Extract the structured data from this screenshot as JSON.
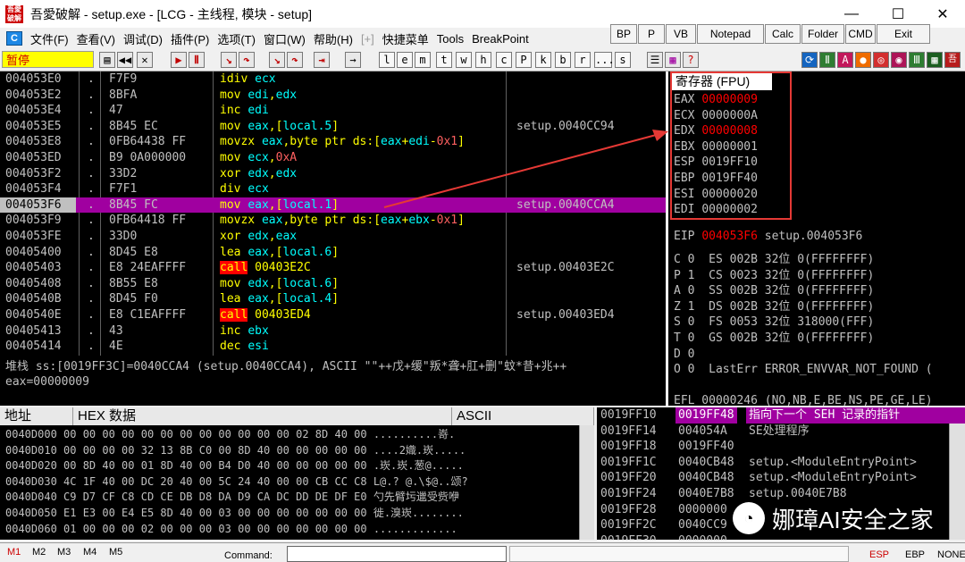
{
  "window": {
    "title": "吾愛破解 - setup.exe - [LCG - 主线程, 模块 - setup]",
    "icon_text": "吾愛破解",
    "minimize": "—",
    "maximize": "☐",
    "close": "✕"
  },
  "menu": {
    "logo": "C",
    "items": [
      "文件(F)",
      "查看(V)",
      "调试(D)",
      "插件(P)",
      "选项(T)",
      "窗口(W)",
      "帮助(H)",
      "[+]",
      "快捷菜单",
      "Tools",
      "BreakPoint"
    ]
  },
  "plugins": [
    "BP",
    "P",
    "VB",
    "Notepad",
    "Calc",
    "Folder",
    "CMD",
    "Exit"
  ],
  "toolbar": {
    "status": "暂停",
    "letters": [
      "l",
      "e",
      "m",
      "t",
      "w",
      "h",
      "c",
      "P",
      "k",
      "b",
      "r",
      "...",
      "s"
    ]
  },
  "disasm": [
    {
      "addr": "004053E0",
      "hex": "F7F9",
      "asm": [
        [
          "idiv ",
          ""
        ],
        [
          "ecx",
          "reg"
        ]
      ],
      "cmt": ""
    },
    {
      "addr": "004053E2",
      "hex": "8BFA",
      "asm": [
        [
          "mov ",
          ""
        ],
        [
          "edi",
          "reg"
        ],
        [
          ",",
          ""
        ],
        [
          "edx",
          "reg"
        ]
      ],
      "cmt": ""
    },
    {
      "addr": "004053E4",
      "hex": "47",
      "asm": [
        [
          "inc ",
          ""
        ],
        [
          "edi",
          "reg"
        ]
      ],
      "cmt": ""
    },
    {
      "addr": "004053E5",
      "hex": "8B45 EC",
      "asm": [
        [
          "mov ",
          ""
        ],
        [
          "eax",
          "reg"
        ],
        [
          ",[",
          ""
        ],
        [
          "local.5",
          "reg"
        ],
        [
          "]",
          ""
        ]
      ],
      "cmt": "setup.0040CC94"
    },
    {
      "addr": "004053E8",
      "hex": "0FB64438 FF",
      "asm": [
        [
          "movzx ",
          ""
        ],
        [
          "eax",
          "reg"
        ],
        [
          ",byte ptr ds:[",
          ""
        ],
        [
          "eax",
          "reg"
        ],
        [
          "+",
          ""
        ],
        [
          "edi",
          "reg"
        ],
        [
          "-",
          ""
        ],
        [
          "0x1",
          "num"
        ],
        [
          "]",
          ""
        ]
      ],
      "cmt": ""
    },
    {
      "addr": "004053ED",
      "hex": "B9 0A000000",
      "asm": [
        [
          "mov ",
          ""
        ],
        [
          "ecx",
          "reg"
        ],
        [
          ",",
          ""
        ],
        [
          "0xA",
          "num"
        ]
      ],
      "cmt": ""
    },
    {
      "addr": "004053F2",
      "hex": "33D2",
      "asm": [
        [
          "xor ",
          ""
        ],
        [
          "edx",
          "reg"
        ],
        [
          ",",
          ""
        ],
        [
          "edx",
          "reg"
        ]
      ],
      "cmt": ""
    },
    {
      "addr": "004053F4",
      "hex": "F7F1",
      "asm": [
        [
          "div ",
          ""
        ],
        [
          "ecx",
          "reg"
        ]
      ],
      "cmt": ""
    },
    {
      "addr": "004053F6",
      "hex": "8B45 FC",
      "asm": [
        [
          "mov ",
          ""
        ],
        [
          "eax",
          "reg"
        ],
        [
          ",[",
          ""
        ],
        [
          "local.1",
          "reg"
        ],
        [
          "]",
          ""
        ]
      ],
      "cmt": "setup.0040CCA4",
      "selected": true
    },
    {
      "addr": "004053F9",
      "hex": "0FB64418 FF",
      "asm": [
        [
          "movzx ",
          ""
        ],
        [
          "eax",
          "reg"
        ],
        [
          ",byte ptr ds:[",
          ""
        ],
        [
          "eax",
          "reg"
        ],
        [
          "+",
          ""
        ],
        [
          "ebx",
          "reg"
        ],
        [
          "-",
          ""
        ],
        [
          "0x1",
          "num"
        ],
        [
          "]",
          ""
        ]
      ],
      "cmt": ""
    },
    {
      "addr": "004053FE",
      "hex": "33D0",
      "asm": [
        [
          "xor ",
          ""
        ],
        [
          "edx",
          "reg"
        ],
        [
          ",",
          ""
        ],
        [
          "eax",
          "reg"
        ]
      ],
      "cmt": ""
    },
    {
      "addr": "00405400",
      "hex": "8D45 E8",
      "asm": [
        [
          "lea ",
          ""
        ],
        [
          "eax",
          "reg"
        ],
        [
          ",[",
          ""
        ],
        [
          "local.6",
          "reg"
        ],
        [
          "]",
          ""
        ]
      ],
      "cmt": ""
    },
    {
      "addr": "00405403",
      "hex": "E8 24EAFFFF",
      "asm": [
        [
          "call",
          "call"
        ],
        [
          " 00403E2C",
          ""
        ]
      ],
      "cmt": "setup.00403E2C"
    },
    {
      "addr": "00405408",
      "hex": "8B55 E8",
      "asm": [
        [
          "mov ",
          ""
        ],
        [
          "edx",
          "reg"
        ],
        [
          ",[",
          ""
        ],
        [
          "local.6",
          "reg"
        ],
        [
          "]",
          ""
        ]
      ],
      "cmt": ""
    },
    {
      "addr": "0040540B",
      "hex": "8D45 F0",
      "asm": [
        [
          "lea ",
          ""
        ],
        [
          "eax",
          "reg"
        ],
        [
          ",[",
          ""
        ],
        [
          "local.4",
          "reg"
        ],
        [
          "]",
          ""
        ]
      ],
      "cmt": ""
    },
    {
      "addr": "0040540E",
      "hex": "E8 C1EAFFFF",
      "asm": [
        [
          "call",
          "call"
        ],
        [
          " 00403ED4",
          ""
        ]
      ],
      "cmt": "setup.00403ED4"
    },
    {
      "addr": "00405413",
      "hex": "43",
      "asm": [
        [
          "inc ",
          ""
        ],
        [
          "ebx",
          "reg"
        ]
      ],
      "cmt": ""
    },
    {
      "addr": "00405414",
      "hex": "4E",
      "asm": [
        [
          "dec ",
          ""
        ],
        [
          "esi",
          "reg"
        ]
      ],
      "cmt": ""
    }
  ],
  "info": {
    "line1": "堆栈 ss:[0019FF3C]=0040CCA4 (setup.0040CCA4), ASCII \"\"++戊+缓\"叛*聋+肛+删\"蚊*昔+兆++",
    "line2": "eax=00000009"
  },
  "registers": {
    "title": "寄存器 (FPU)",
    "gp": [
      [
        "EAX",
        "00000009",
        true
      ],
      [
        "ECX",
        "0000000A",
        false
      ],
      [
        "EDX",
        "00000008",
        true
      ],
      [
        "EBX",
        "00000001",
        false
      ],
      [
        "ESP",
        "0019FF10",
        false
      ],
      [
        "EBP",
        "0019FF40",
        false
      ],
      [
        "ESI",
        "00000020",
        false
      ],
      [
        "EDI",
        "00000002",
        false
      ]
    ],
    "eip": {
      "label": "EIP",
      "value": "004053F6",
      "comment": "setup.004053F6"
    },
    "flags": [
      "C 0  ES 002B 32位 0(FFFFFFFF)",
      "P 1  CS 0023 32位 0(FFFFFFFF)",
      "A 0  SS 002B 32位 0(FFFFFFFF)",
      "Z 1  DS 002B 32位 0(FFFFFFFF)",
      "S 0  FS 0053 32位 318000(FFF)",
      "T 0  GS 002B 32位 0(FFFFFFFF)",
      "D 0",
      "O 0  LastErr ERROR_ENVVAR_NOT_FOUND (",
      "",
      "EFL 00000246 (NO,NB,E,BE,NS,PE,GE,LE)"
    ]
  },
  "dump": {
    "headers": [
      "地址",
      "HEX 数据",
      "ASCII"
    ],
    "rows": [
      [
        "0040D000",
        "00 00 00 00 00 00 00 00 00 00 00 00 02 8D 40 00",
        "..........\u0002嵜."
      ],
      [
        "0040D010",
        "00 00 00 00 32 13 8B C0 00 8D 40 00 00 00 00 00",
        "....2\u0013嬂.崁....."
      ],
      [
        "0040D020",
        "00 8D 40 00 01 8D 40 00 B4 D0 40 00 00 00 00 00",
        ".崁.\u0001崁.葱@....."
      ],
      [
        "0040D030",
        "4C 1F 40 00 DC 20 40 00 5C 24 40 00 00 CB CC C8",
        "L\u001f@.? @.\\$@..颂?"
      ],
      [
        "0040D040",
        "C9 D7 CF C8 CD CE DB D8 DA D9 CA DC DD DE DF E0",
        "勺先臂圬邋受赀咿"
      ],
      [
        "0040D050",
        "E1 E3 00 E4 E5 8D 40 00 03 00 00 00 00 00 00 00",
        "徙.溴崁.\u0003......."
      ],
      [
        "0040D060",
        "01 00 00 00 02 00 00 00 03 00 00 00 00 00 00 00",
        "\u0001...\u0002...\u0003......."
      ]
    ]
  },
  "stack": {
    "head": {
      "addr": "0019FF10",
      "val": "0019FF48",
      "cmt": "指向下一个 SEH 记录的指针"
    },
    "rows": [
      [
        "0019FF14",
        "004054A",
        "SE处理程序"
      ],
      [
        "0019FF18",
        "0019FF40",
        ""
      ],
      [
        "0019FF1C",
        "0040CB48",
        "setup.<ModuleEntryPoint>"
      ],
      [
        "0019FF20",
        "0040CB48",
        "setup.<ModuleEntryPoint>"
      ],
      [
        "0019FF24",
        "0040E7B8",
        "setup.0040E7B8"
      ],
      [
        "0019FF28",
        "0000000",
        ""
      ],
      [
        "0019FF2C",
        "0040CC9",
        ""
      ],
      [
        "0019FF30",
        "0000000",
        ""
      ]
    ]
  },
  "watermark": "娜璋AI安全之家",
  "bottom": {
    "m_buttons": [
      "M1",
      "M2",
      "M3",
      "M4",
      "M5"
    ],
    "command_label": "Command:",
    "regs": [
      "ESP",
      "EBP",
      "NONE"
    ]
  },
  "colors": {
    "selection": "#a000a0",
    "highlight_red": "#e53935",
    "asm_yellow": "#ffff00",
    "reg_cyan": "#00ffff"
  }
}
